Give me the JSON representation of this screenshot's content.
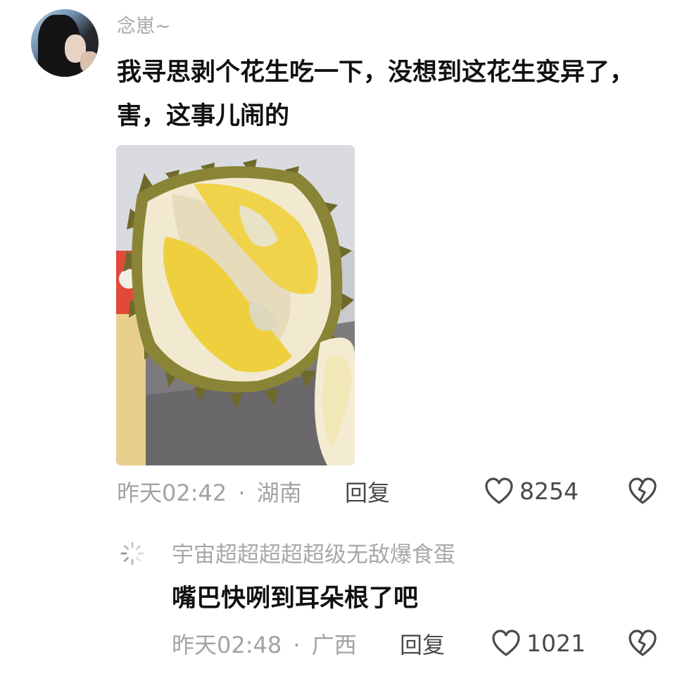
{
  "main_comment": {
    "username": "念崽~",
    "text": "我寻思剥个花生吃一下，没想到这花生变异了，害，这事儿闹的",
    "time": "昨天02:42",
    "separator": "·",
    "location": "湖南",
    "reply_label": "回复",
    "like_count": "8254"
  },
  "sub_comment": {
    "username": "宇宙超超超超超级无敌爆食蛋",
    "text": "嘴巴快咧到耳朵根了吧",
    "time": "昨天02:48",
    "separator": "·",
    "location": "广西",
    "reply_label": "回复",
    "like_count": "1021"
  },
  "icons": {
    "like": "heart-outline-icon",
    "dislike": "broken-heart-icon",
    "sub_avatar": "loading-spinner-icon"
  },
  "colors": {
    "text_primary": "#111111",
    "text_secondary": "#a8a8a8",
    "action_text": "#4a4a4a"
  }
}
